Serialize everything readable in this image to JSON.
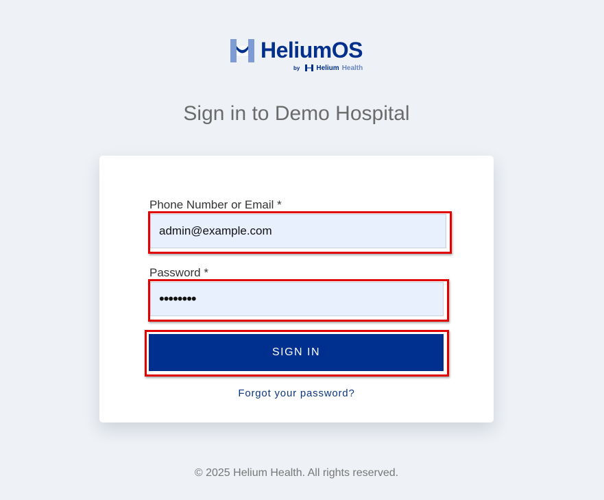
{
  "brand": {
    "name": "HeliumOS",
    "by": "by",
    "parent_name_part1": "Helium",
    "parent_name_part2": "Health",
    "primary_color": "#002f8c",
    "secondary_color": "#6b86c0"
  },
  "heading": "Sign in to Demo Hospital",
  "form": {
    "email": {
      "label": "Phone Number or Email *",
      "value": "admin@example.com"
    },
    "password": {
      "label": "Password *",
      "value": "••••••••"
    },
    "submit_label": "SIGN IN",
    "forgot_link": "Forgot your password?"
  },
  "footer": "© 2025 Helium Health. All rights reserved.",
  "colors": {
    "background": "#eef1f5",
    "button": "#00308f",
    "input_fill": "#e8f0fe",
    "highlight_frame": "#e00000"
  }
}
